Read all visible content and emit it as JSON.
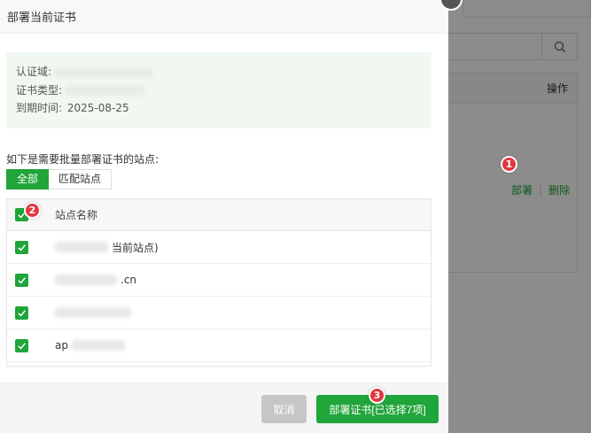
{
  "background": {
    "table_header_action": "操作",
    "actions": {
      "deploy": "部署",
      "delete": "删除"
    }
  },
  "dialog": {
    "title": "部署当前证书",
    "info": {
      "domain_label": "认证域:",
      "type_label": "证书类型:",
      "expiry_label": "到期时间:",
      "expiry_value": "2025-08-25"
    },
    "sites_title": "如下是需要批量部署证书的站点:",
    "tabs": [
      {
        "label": "全部",
        "active": true
      },
      {
        "label": "匹配站点",
        "active": false
      }
    ],
    "table": {
      "header": "站点名称",
      "rows": [
        {
          "name_visible": "当前站点)",
          "checked": true
        },
        {
          "name_visible": ".cn",
          "checked": true
        },
        {
          "name_visible": "",
          "checked": true
        },
        {
          "name_visible": "ap",
          "checked": true
        }
      ]
    },
    "footer": {
      "cancel_label": "取消",
      "deploy_label": "部署证书[已选择7项]"
    }
  },
  "badges": [
    "1",
    "2",
    "3"
  ],
  "colors": {
    "accent": "#20a53a",
    "badge": "#e0383e",
    "info_bg": "#f1f8f1"
  }
}
